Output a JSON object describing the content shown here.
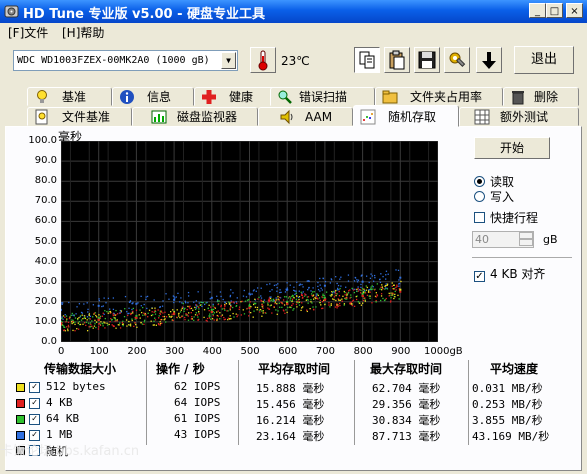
{
  "window": {
    "title": "HD Tune 专业版 v5.00 - 硬盘专业工具",
    "min_label": "_",
    "max_label": "□",
    "close_label": "×"
  },
  "menu": {
    "file": "[F]文件",
    "help": "[H]帮助"
  },
  "toolbar": {
    "drive": "WDC WD1003FZEX-00MK2A0 (1000 gB)",
    "temperature": "23℃",
    "exit_label": "退出"
  },
  "tabs_row1": [
    {
      "label": "基准",
      "icon": "lightbulb-icon"
    },
    {
      "label": "信息",
      "icon": "info-icon"
    },
    {
      "label": "健康",
      "icon": "health-cross-icon"
    },
    {
      "label": "错误扫描",
      "icon": "magnifier-icon"
    },
    {
      "label": "文件夹占用率",
      "icon": "folder-icon"
    },
    {
      "label": "删除",
      "icon": "trash-icon"
    }
  ],
  "tabs_row2": [
    {
      "label": "文件基准",
      "icon": "file-bulb-icon"
    },
    {
      "label": "磁盘监视器",
      "icon": "monitor-chart-icon"
    },
    {
      "label": "AAM",
      "icon": "speaker-icon"
    },
    {
      "label": "随机存取",
      "icon": "scatter-icon",
      "active": true
    },
    {
      "label": "额外测试",
      "icon": "grid-icon"
    }
  ],
  "controls": {
    "start_label": "开始",
    "read_label": "读取",
    "write_label": "写入",
    "read_selected": true,
    "short_stroke_label": "快捷行程",
    "short_stroke_checked": false,
    "short_stroke_value": "40",
    "short_stroke_unit": "gB",
    "align_label": "4 KB 对齐",
    "align_checked": true
  },
  "chart_data": {
    "type": "scatter",
    "title": "",
    "ylabel": "毫秒",
    "xlabel": "",
    "xlim": [
      0,
      1000
    ],
    "ylim": [
      0,
      100
    ],
    "x_ticks": [
      "0",
      "100",
      "200",
      "300",
      "400",
      "500",
      "600",
      "700",
      "800",
      "900",
      "1000gB"
    ],
    "y_ticks": [
      "100.0",
      "90.0",
      "80.0",
      "70.0",
      "60.0",
      "50.0",
      "40.0",
      "30.0",
      "20.0",
      "10.0",
      "0.0"
    ],
    "grid": true,
    "background": "#000000",
    "series": [
      {
        "name": "512 bytes",
        "color": "#f0e020",
        "x": [
          0,
          100,
          200,
          300,
          400,
          500,
          600,
          700,
          800,
          900
        ],
        "y": [
          9,
          11,
          12,
          14,
          15,
          17,
          19,
          21,
          23,
          26
        ]
      },
      {
        "name": "4 KB",
        "color": "#e02020",
        "x": [
          0,
          100,
          200,
          300,
          400,
          500,
          600,
          700,
          800,
          900
        ],
        "y": [
          9,
          11,
          12,
          14,
          15,
          17,
          19,
          21,
          23,
          25
        ]
      },
      {
        "name": "64 KB",
        "color": "#30c030",
        "x": [
          0,
          100,
          200,
          300,
          400,
          500,
          600,
          700,
          800,
          900
        ],
        "y": [
          10,
          12,
          13,
          15,
          16,
          18,
          20,
          22,
          24,
          26
        ]
      },
      {
        "name": "1 MB",
        "color": "#3070e0",
        "x": [
          0,
          100,
          200,
          300,
          400,
          500,
          600,
          700,
          800,
          900
        ],
        "y": [
          16,
          18,
          19,
          21,
          22,
          24,
          26,
          28,
          30,
          32
        ]
      }
    ]
  },
  "results": {
    "headers": [
      "传输数据大小",
      "操作 / 秒",
      "平均存取时间",
      "最大存取时间",
      "平均速度"
    ],
    "rows": [
      {
        "size": "512 bytes",
        "color": "#f0e020",
        "checked": true,
        "ops": "62 IOPS",
        "avg": "15.888 毫秒",
        "max": "62.704 毫秒",
        "speed": "0.031 MB/秒"
      },
      {
        "size": "4 KB",
        "color": "#e02020",
        "checked": true,
        "ops": "64 IOPS",
        "avg": "15.456 毫秒",
        "max": "29.356 毫秒",
        "speed": "0.253 MB/秒"
      },
      {
        "size": "64 KB",
        "color": "#30c030",
        "checked": true,
        "ops": "61 IOPS",
        "avg": "16.214 毫秒",
        "max": "30.834 毫秒",
        "speed": "3.855 MB/秒"
      },
      {
        "size": "1 MB",
        "color": "#3070e0",
        "checked": true,
        "ops": "43 IOPS",
        "avg": "23.164 毫秒",
        "max": "87.713 毫秒",
        "speed": "43.169 MB/秒"
      },
      {
        "size": "随机",
        "color": "#c0c0c0",
        "checked": false,
        "ops": "",
        "avg": "",
        "max": "",
        "speed": ""
      }
    ]
  },
  "watermark": "卡饭论坛 bbs.kafan.cn"
}
